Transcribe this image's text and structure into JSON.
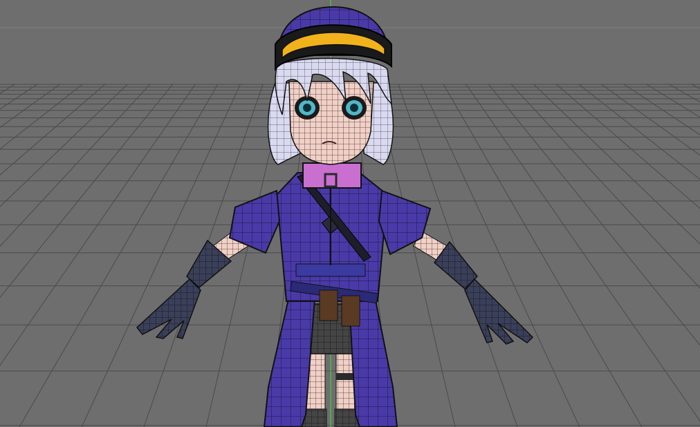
{
  "viewport": {
    "view_name": "",
    "shading": "wireframe-on-shaded",
    "grid": true
  },
  "scene": {
    "model": {
      "icon": "character-model",
      "description_visible": false
    }
  },
  "colors": {
    "background": "#6e6e6e",
    "grid_line": "#4a4a4a",
    "y_axis": "#3bd13b",
    "outfit": "#4a3aa8",
    "skin": "#f1d0c6",
    "hair": "#d9daf0",
    "collar": "#c86fd0",
    "visor": "#f2b21c",
    "wire": "#1b1b1b"
  }
}
